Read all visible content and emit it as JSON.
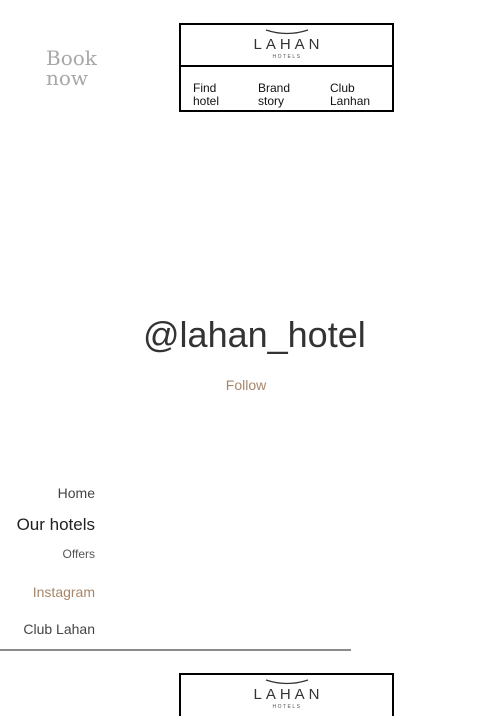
{
  "book_now": {
    "label": "Book now"
  },
  "header": {
    "logo": {
      "word": "LAHAN",
      "sub": "HOTELS"
    },
    "nav": [
      {
        "label": "Find hotel"
      },
      {
        "label": "Brand story"
      },
      {
        "label": "Club Lanhan"
      }
    ]
  },
  "instagram": {
    "handle": "@lahan_hotel",
    "follow_label": "Follow"
  },
  "menu": [
    {
      "label": "Home"
    },
    {
      "label": "Our hotels"
    },
    {
      "label": "Offers"
    },
    {
      "label": "Instagram"
    },
    {
      "label": "Club Lahan"
    }
  ],
  "footer": {
    "logo": {
      "word": "LAHAN",
      "sub": "HOTELS"
    }
  },
  "colors": {
    "accent": "#a7866a",
    "muted": "#a8a8a8",
    "divider": "#8c8c8c"
  }
}
